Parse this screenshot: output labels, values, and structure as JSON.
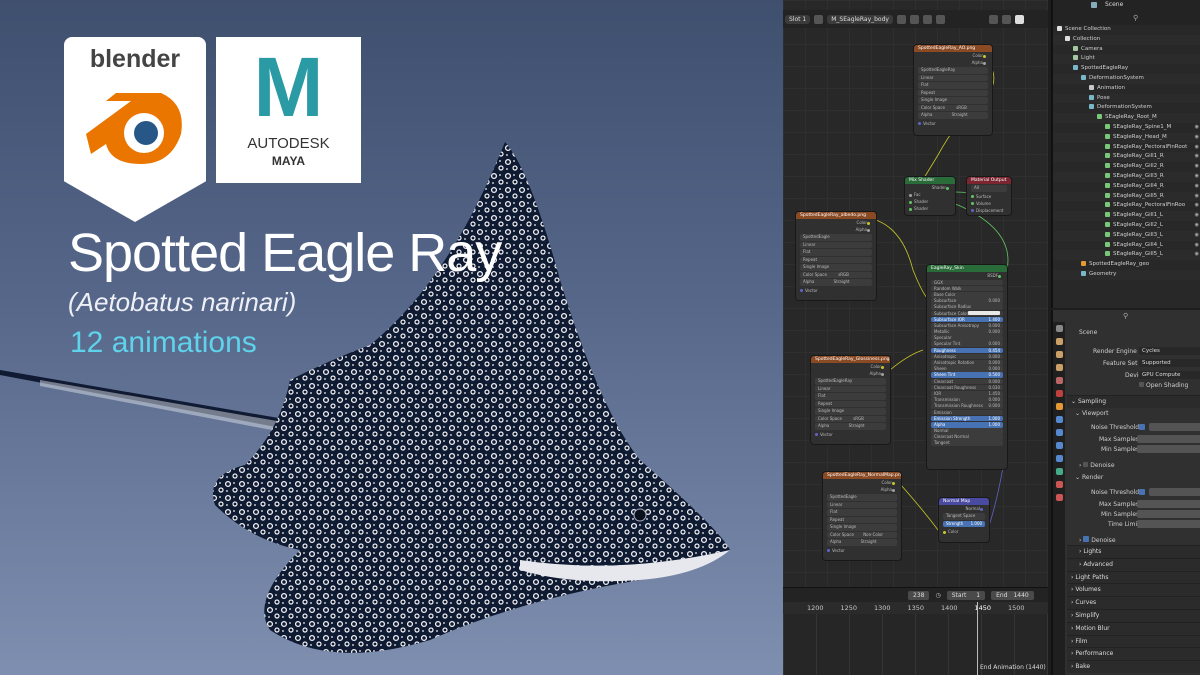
{
  "promo": {
    "blender_logo_text": "blender",
    "maya_logo_letter": "M",
    "maya_logo_line1": "AUTODESK",
    "maya_logo_line2": "MAYA",
    "title": "Spotted Eagle Ray",
    "subtitle": "(Aetobatus narinari)",
    "animation_count": "12 animations",
    "colors": {
      "accent": "#5ed3ea",
      "bg_top": "#3f4f6e",
      "bg_bottom": "#7f8fb0",
      "blender_orange": "#ea7600",
      "blender_blue": "#265787",
      "maya_teal": "#2a9aa5"
    }
  },
  "node_editor": {
    "header": {
      "slot": "Slot 1",
      "material": "M_SEagleRay_body"
    },
    "nodes": {
      "ao_tex": {
        "title": "SpottedEagleRay_AO.png",
        "image": "SpottedEagleRay",
        "rows": [
          "Linear",
          "Flat",
          "Repeat",
          "Single Image",
          "Color Space",
          "Alpha"
        ],
        "vals": [
          "",
          "",
          "",
          "",
          "sRGB",
          "Straight"
        ],
        "footer": "Vector",
        "outs": [
          "Color",
          "Alpha"
        ]
      },
      "base_tex": {
        "title": "SpottedEagleRay_albedo.png",
        "image": "SpottedEagle",
        "rows": [
          "Linear",
          "Flat",
          "Repeat",
          "Single Image",
          "Color Space",
          "Alpha"
        ],
        "vals": [
          "",
          "",
          "",
          "",
          "sRGB",
          "Straight"
        ],
        "footer": "Vector",
        "outs": [
          "Color",
          "Alpha"
        ]
      },
      "mix": {
        "title": "Mix Shader",
        "inputs": [
          "Fac",
          "Shader",
          "Shader"
        ],
        "out": "Shader"
      },
      "output": {
        "title": "Material Output",
        "select": "All",
        "inputs": [
          "Surface",
          "Volume",
          "Displacement"
        ]
      },
      "principled": {
        "title": "EagleRay_Skin",
        "out": "BSDF",
        "rows": [
          "GGX",
          "Random Walk",
          "Base Color",
          "Subsurface",
          "Subsurface Radius",
          "Subsurface Color",
          "Subsurface IOR",
          "Subsurface Anisotropy",
          "Metallic",
          "Specular",
          "Specular Tint",
          "Roughness",
          "Anisotropic",
          "Anisotropic Rotation",
          "Sheen",
          "Sheen Tint",
          "Clearcoat",
          "Clearcoat Roughness",
          "IOR",
          "Transmission",
          "Transmission Roughness",
          "Emission",
          "Emission Strength",
          "Alpha",
          "Normal",
          "Clearcoat Normal",
          "Tangent"
        ],
        "vals": [
          "",
          "",
          "",
          "0.000",
          "",
          "",
          "1.400",
          "0.000",
          "0.000",
          "",
          "0.000",
          "0.454",
          "0.000",
          "0.000",
          "0.000",
          "0.500",
          "0.000",
          "0.030",
          "1.450",
          "0.000",
          "0.000",
          "",
          "1.000",
          "1.000",
          "",
          "",
          ""
        ]
      },
      "rough_tex": {
        "title": "SpottedEagleRay_Glossiness.png",
        "image": "SpottedEagleRay",
        "rows": [
          "Linear",
          "Flat",
          "Repeat",
          "Single Image",
          "Color Space",
          "Alpha"
        ],
        "vals": [
          "",
          "",
          "",
          "",
          "sRGB",
          "Straight"
        ],
        "footer": "Vector",
        "outs": [
          "Color",
          "Alpha"
        ]
      },
      "normal_tex": {
        "title": "SpottedEagleRay_NormalMap.png",
        "image": "SpottedEagle",
        "rows": [
          "Linear",
          "Flat",
          "Repeat",
          "Single Image",
          "Color Space",
          "Alpha"
        ],
        "vals": [
          "",
          "",
          "",
          "",
          "Non-Color",
          "Straight"
        ],
        "footer": "Vector",
        "outs": [
          "Color",
          "Alpha"
        ]
      },
      "normal_map": {
        "title": "Normal Map",
        "out": "Normal",
        "space": "Tangent Space",
        "strength_label": "Strength",
        "strength": "1.000",
        "input": "Color"
      }
    }
  },
  "timeline": {
    "current_frame": "238",
    "start_label": "Start",
    "start_value": "1",
    "end_label": "End",
    "end_value": "1440",
    "ticks": [
      "1200",
      "1250",
      "1300",
      "1350",
      "1400",
      "1450",
      "1500"
    ],
    "marker": "End Animation (1440)"
  },
  "outliner": {
    "scene": "Scene",
    "items": [
      {
        "label": "Scene Collection",
        "depth": 0,
        "icon": "collection"
      },
      {
        "label": "Collection",
        "depth": 1,
        "icon": "collection"
      },
      {
        "label": "Camera",
        "depth": 2,
        "icon": "camera"
      },
      {
        "label": "Light",
        "depth": 2,
        "icon": "light"
      },
      {
        "label": "SpottedEagleRay",
        "depth": 2,
        "icon": "armature"
      },
      {
        "label": "DeformationSystem",
        "depth": 3,
        "icon": "armature"
      },
      {
        "label": "Animation",
        "depth": 4,
        "icon": "action"
      },
      {
        "label": "Pose",
        "depth": 4,
        "icon": "pose"
      },
      {
        "label": "DeformationSystem",
        "depth": 4,
        "icon": "armature"
      },
      {
        "label": "SEagleRay_Root_M",
        "depth": 5,
        "icon": "bone"
      },
      {
        "label": "SEagleRay_Spine1_M",
        "depth": 6,
        "icon": "bone"
      },
      {
        "label": "SEagleRay_Head_M",
        "depth": 6,
        "icon": "bone"
      },
      {
        "label": "SEagleRay_PectoralFinRoot",
        "depth": 6,
        "icon": "bone"
      },
      {
        "label": "SEagleRay_Gill1_R",
        "depth": 6,
        "icon": "bone"
      },
      {
        "label": "SEagleRay_Gill2_R",
        "depth": 6,
        "icon": "bone"
      },
      {
        "label": "SEagleRay_Gill3_R",
        "depth": 6,
        "icon": "bone"
      },
      {
        "label": "SEagleRay_Gill4_R",
        "depth": 6,
        "icon": "bone"
      },
      {
        "label": "SEagleRay_Gill5_R",
        "depth": 6,
        "icon": "bone"
      },
      {
        "label": "SEagleRay_PectoralFinRoo",
        "depth": 6,
        "icon": "bone"
      },
      {
        "label": "SEagleRay_Gill1_L",
        "depth": 6,
        "icon": "bone"
      },
      {
        "label": "SEagleRay_Gill2_L",
        "depth": 6,
        "icon": "bone"
      },
      {
        "label": "SEagleRay_Gill3_L",
        "depth": 6,
        "icon": "bone"
      },
      {
        "label": "SEagleRay_Gill4_L",
        "depth": 6,
        "icon": "bone"
      },
      {
        "label": "SEagleRay_Gill5_L",
        "depth": 6,
        "icon": "bone"
      },
      {
        "label": "SpottedEagleRay_geo",
        "depth": 3,
        "icon": "mesh"
      },
      {
        "label": "Geometry",
        "depth": 3,
        "icon": "geometry"
      }
    ]
  },
  "properties": {
    "scene": "Scene",
    "render_engine_label": "Render Engine",
    "render_engine": "Cycles",
    "feature_set_label": "Feature Set",
    "feature_set": "Supported",
    "device_label": "Device",
    "device": "GPU Compute",
    "open_shading": "Open Shading",
    "sampling": "Sampling",
    "viewport": "Viewport",
    "noise_threshold": "Noise Threshold",
    "max_samples": "Max Samples",
    "min_samples": "Min Samples",
    "denoise": "Denoise",
    "render": "Render",
    "time_limit": "Time Limit",
    "sections": [
      "Lights",
      "Advanced",
      "Light Paths",
      "Volumes",
      "Curves",
      "Simplify",
      "Motion Blur",
      "Film",
      "Performance",
      "Bake"
    ]
  }
}
